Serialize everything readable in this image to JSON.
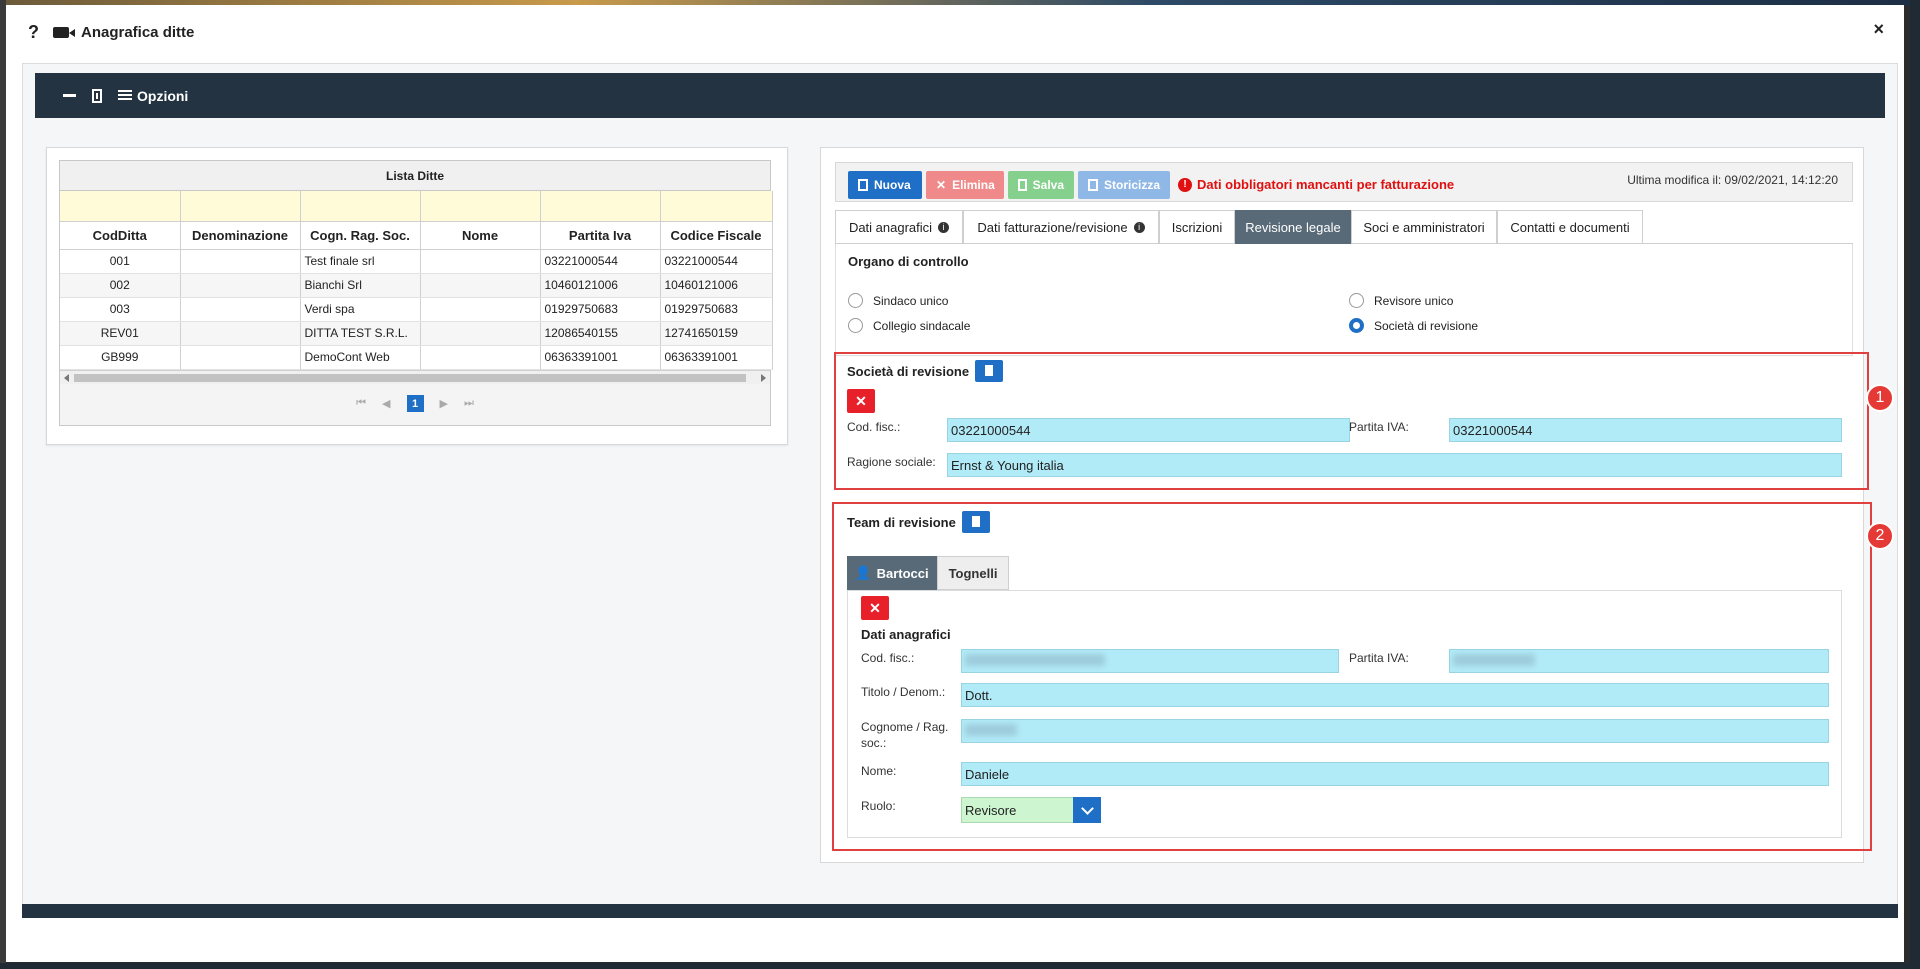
{
  "window": {
    "help": "?",
    "title": "Anagrafica ditte",
    "close": "×"
  },
  "toolbar": {
    "options_label": "Opzioni"
  },
  "grid": {
    "title": "Lista Ditte",
    "columns": [
      "CodDitta",
      "Denominazione",
      "Cogn. Rag. Soc.",
      "Nome",
      "Partita Iva",
      "Codice Fiscale"
    ],
    "rows": [
      [
        "001",
        "",
        "Test finale srl",
        "",
        "03221000544",
        "03221000544"
      ],
      [
        "002",
        "",
        "Bianchi Srl",
        "",
        "10460121006",
        "10460121006"
      ],
      [
        "003",
        "",
        "Verdi spa",
        "",
        "01929750683",
        "01929750683"
      ],
      [
        "REV01",
        "",
        "DITTA TEST S.R.L.",
        "",
        "12086540155",
        "12741650159"
      ],
      [
        "GB999",
        "",
        "DemoCont Web",
        "",
        "06363391001",
        "06363391001"
      ]
    ],
    "pager": {
      "current_page": "1"
    }
  },
  "actions": {
    "nuova": "Nuova",
    "elimina": "Elimina",
    "salva": "Salva",
    "storicizza": "Storicizza",
    "warning": "Dati obbligatori mancanti per fatturazione",
    "last_modified": "Ultima modifica il: 09/02/2021, 14:12:20"
  },
  "tabs": [
    {
      "label": "Dati anagrafici",
      "info": true
    },
    {
      "label": "Dati fatturazione/revisione",
      "info": true
    },
    {
      "label": "Iscrizioni",
      "info": false
    },
    {
      "label": "Revisione legale",
      "info": false,
      "active": true
    },
    {
      "label": "Soci e amministratori",
      "info": false
    },
    {
      "label": "Contatti e documenti",
      "info": false
    }
  ],
  "organo": {
    "title": "Organo di controllo",
    "options": {
      "sindaco_unico": "Sindaco unico",
      "collegio_sindacale": "Collegio sindacale",
      "revisore_unico": "Revisore unico",
      "societa_revisione": "Società di revisione"
    },
    "selected": "Società di revisione"
  },
  "societa": {
    "title": "Società di revisione",
    "cod_fisc_label": "Cod. fisc.:",
    "cod_fisc_value": "03221000544",
    "piva_label": "Partita IVA:",
    "piva_value": "03221000544",
    "ragione_label": "Ragione sociale:",
    "ragione_value": "Ernst & Young italia"
  },
  "team": {
    "title": "Team di revisione",
    "tabs": [
      "Bartocci",
      "Tognelli"
    ],
    "section_title": "Dati anagrafici",
    "cod_fisc_label": "Cod. fisc.:",
    "piva_label": "Partita IVA:",
    "titolo_label": "Titolo / Denom.:",
    "titolo_value": "Dott.",
    "cognome_label": "Cognome / Rag. soc.:",
    "nome_label": "Nome:",
    "nome_value": "Daniele",
    "ruolo_label": "Ruolo:",
    "ruolo_value": "Revisore"
  },
  "annotations": {
    "badge1": "1",
    "badge2": "2"
  },
  "colors": {
    "accent": "#1e6fc5",
    "danger": "#e8202a",
    "toolbar": "#233342",
    "field": "#b2ebf8",
    "tab_active": "#586a78"
  }
}
